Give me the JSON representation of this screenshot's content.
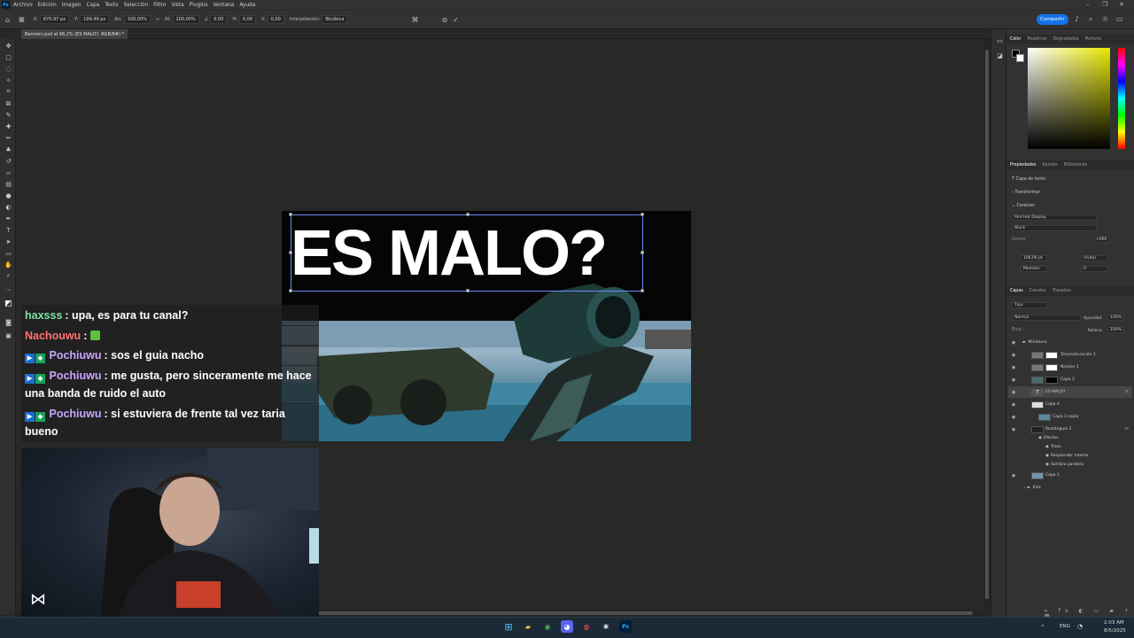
{
  "menubar": {
    "app_icon": "Ps",
    "items": [
      "Archivo",
      "Edición",
      "Imagen",
      "Capa",
      "Texto",
      "Selección",
      "Filtro",
      "Vista",
      "Plugins",
      "Ventana",
      "Ayuda"
    ]
  },
  "options_bar": {
    "x_label": "X:",
    "x_value": "670,97 px",
    "y_label": "Y:",
    "y_value": "199,49 px",
    "w_label": "An:",
    "w_value": "100,00%",
    "h_label": "Al:",
    "h_value": "100,00%",
    "angle_value": "0,00",
    "hskew_label": "H:",
    "hskew_value": "0,00",
    "vskew_label": "V:",
    "vskew_value": "0,00",
    "interp_label": "Interpolación:",
    "interp_value": "Bicúbica",
    "share_label": "Compartir"
  },
  "document": {
    "tab_title": "Banners.psd al 48,2% (ES MALO?, RGB/8#) *"
  },
  "canvas": {
    "headline": "ES MALO?"
  },
  "color_panel": {
    "tabs": [
      "Color",
      "Muestras",
      "Degradados",
      "Motivos"
    ],
    "accent": "#e8e800"
  },
  "properties_panel": {
    "tabs": [
      "Propiedades",
      "Ajustes",
      "Bibliotecas"
    ],
    "layer_kind": "Capa de texto",
    "section_transform": "Transformar",
    "section_character": "Carácter",
    "font_family": "Red Hat Display",
    "font_style": "Black",
    "size_value": "106,06 pt",
    "leading_value": "(Auto)",
    "tracking_label": "Medidas",
    "kerning_value": "0",
    "weight_label": "Grosor",
    "weight_value": "+900"
  },
  "layers_panel": {
    "tabs": [
      "Capas",
      "Canales",
      "Trazados"
    ],
    "search_placeholder": "Tipo",
    "blend_mode": "Normal",
    "opacity_label": "Opacidad:",
    "opacity_value": "100%",
    "lock_label": "Bloq.:",
    "fill_label": "Relleno:",
    "fill_value": "100%",
    "layers": [
      {
        "name": "Miniatura"
      },
      {
        "name": "Tono/saturación 1"
      },
      {
        "name": "Niveles 1"
      },
      {
        "name": "Capa 2"
      },
      {
        "name": "ES MALO?"
      },
      {
        "name": "Capa 4"
      },
      {
        "name": "Capa 3 copia"
      },
      {
        "name": "Rectángulo 2"
      },
      {
        "name": "Efectos"
      },
      {
        "name": "Trazo"
      },
      {
        "name": "Resplandor interior"
      },
      {
        "name": "Sombra paralela"
      },
      {
        "name": "Capa 1"
      },
      {
        "name": "Kick"
      }
    ],
    "fx_label": "fx"
  },
  "chat": {
    "messages": [
      {
        "user": "haxsss",
        "user_color": "#7fe0a0",
        "text": ": upa, es para tu canal?"
      },
      {
        "user": "Nachouwu",
        "user_color": "#ff7070",
        "text": ":"
      },
      {
        "user": "Pochiuwu",
        "user_color": "#c9a6ff",
        "text": ": sos el guia nacho"
      },
      {
        "user": "Pochiuwu",
        "user_color": "#c9a6ff",
        "text": ": me gusta, pero sinceramente me hace una banda de ruido el auto"
      },
      {
        "user": "Pochiuwu",
        "user_color": "#c9a6ff",
        "text": ": si estuviera de frente tal vez taria bueno"
      }
    ]
  },
  "taskbar": {
    "lang": "ENG",
    "time": "2:03 AM",
    "date": "8/5/2025"
  }
}
